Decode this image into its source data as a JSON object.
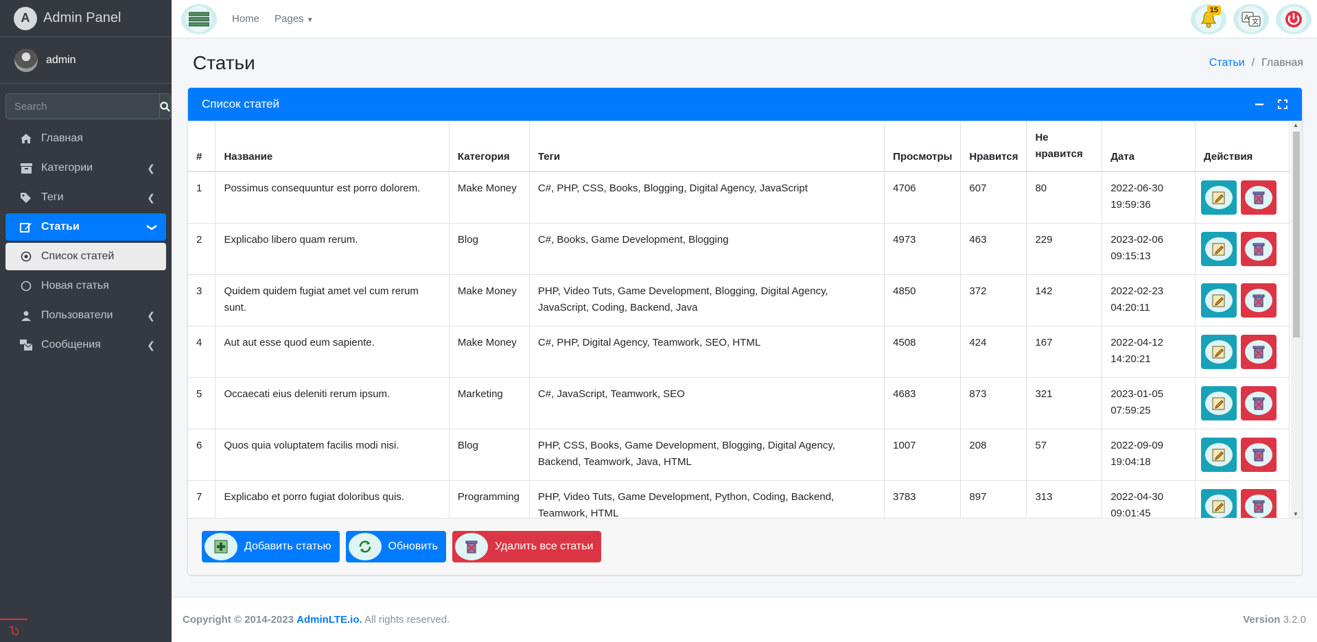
{
  "brand": {
    "title": "Admin Panel",
    "logo_letter": "A"
  },
  "user": {
    "name": "admin"
  },
  "search": {
    "placeholder": "Search"
  },
  "sidebar": {
    "items": [
      {
        "label": "Главная",
        "icon": "home-icon"
      },
      {
        "label": "Категории",
        "icon": "archive-icon"
      },
      {
        "label": "Теги",
        "icon": "tags-icon"
      },
      {
        "label": "Статьи",
        "icon": "edit-icon"
      },
      {
        "label": "Список статей",
        "icon": "dot-circle-icon"
      },
      {
        "label": "Новая статья",
        "icon": "circle-icon"
      },
      {
        "label": "Пользователи",
        "icon": "user-icon"
      },
      {
        "label": "Сообщения",
        "icon": "mail-bulk-icon"
      }
    ]
  },
  "topnav": {
    "home": "Home",
    "pages": "Pages",
    "notifications_count": "15"
  },
  "header": {
    "title": "Статьи",
    "breadcrumb_link": "Статьи",
    "breadcrumb_current": "Главная"
  },
  "card": {
    "title": "Список статей"
  },
  "table": {
    "headers": {
      "num": "#",
      "name": "Название",
      "category": "Категория",
      "tags": "Теги",
      "views": "Просмотры",
      "likes": "Нравится",
      "dislikes_1": "Не",
      "dislikes_2": "нравится",
      "date": "Дата",
      "actions": "Действия"
    },
    "rows": [
      {
        "num": "1",
        "name": "Possimus consequuntur est porro dolorem.",
        "category": "Make Money",
        "tags": "C#, PHP, CSS, Books, Blogging, Digital Agency, JavaScript",
        "views": "4706",
        "likes": "607",
        "dislikes": "80",
        "date1": "2022-06-30",
        "date2": "19:59:36"
      },
      {
        "num": "2",
        "name": "Explicabo libero quam rerum.",
        "category": "Blog",
        "tags": "C#, Books, Game Development, Blogging",
        "views": "4973",
        "likes": "463",
        "dislikes": "229",
        "date1": "2023-02-06",
        "date2": "09:15:13"
      },
      {
        "num": "3",
        "name": "Quidem quidem fugiat amet vel cum rerum sunt.",
        "category": "Make Money",
        "tags": "PHP, Video Tuts, Game Development, Blogging, Digital Agency, JavaScript, Coding, Backend, Java",
        "views": "4850",
        "likes": "372",
        "dislikes": "142",
        "date1": "2022-02-23",
        "date2": "04:20:11"
      },
      {
        "num": "4",
        "name": "Aut aut esse quod eum sapiente.",
        "category": "Make Money",
        "tags": "C#, PHP, Digital Agency, Teamwork, SEO, HTML",
        "views": "4508",
        "likes": "424",
        "dislikes": "167",
        "date1": "2022-04-12",
        "date2": "14:20:21"
      },
      {
        "num": "5",
        "name": "Occaecati eius deleniti rerum ipsum.",
        "category": "Marketing",
        "tags": "C#, JavaScript, Teamwork, SEO",
        "views": "4683",
        "likes": "873",
        "dislikes": "321",
        "date1": "2023-01-05",
        "date2": "07:59:25"
      },
      {
        "num": "6",
        "name": "Quos quia voluptatem facilis modi nisi.",
        "category": "Blog",
        "tags": "PHP, CSS, Books, Game Development, Blogging, Digital Agency, Backend, Teamwork, Java, HTML",
        "views": "1007",
        "likes": "208",
        "dislikes": "57",
        "date1": "2022-09-09",
        "date2": "19:04:18"
      },
      {
        "num": "7",
        "name": "Explicabo et porro fugiat doloribus quis.",
        "category": "Programming",
        "tags": "PHP, Video Tuts, Game Development, Python, Coding, Backend, Teamwork, HTML",
        "views": "3783",
        "likes": "897",
        "dislikes": "313",
        "date1": "2022-04-30",
        "date2": "09:01:45"
      }
    ]
  },
  "footer_buttons": {
    "add": "Добавить статью",
    "refresh": "Обновить",
    "delete_all": "Удалить все статьи"
  },
  "footer": {
    "copyright": "Copyright © 2014-2023",
    "brand": "AdminLTE.io.",
    "rights": "All rights reserved.",
    "version_label": "Version",
    "version": "3.2.0"
  },
  "colors": {
    "primary": "#007bff",
    "danger": "#dc3545",
    "info": "#17a2b8",
    "sidebar": "#343a40"
  }
}
